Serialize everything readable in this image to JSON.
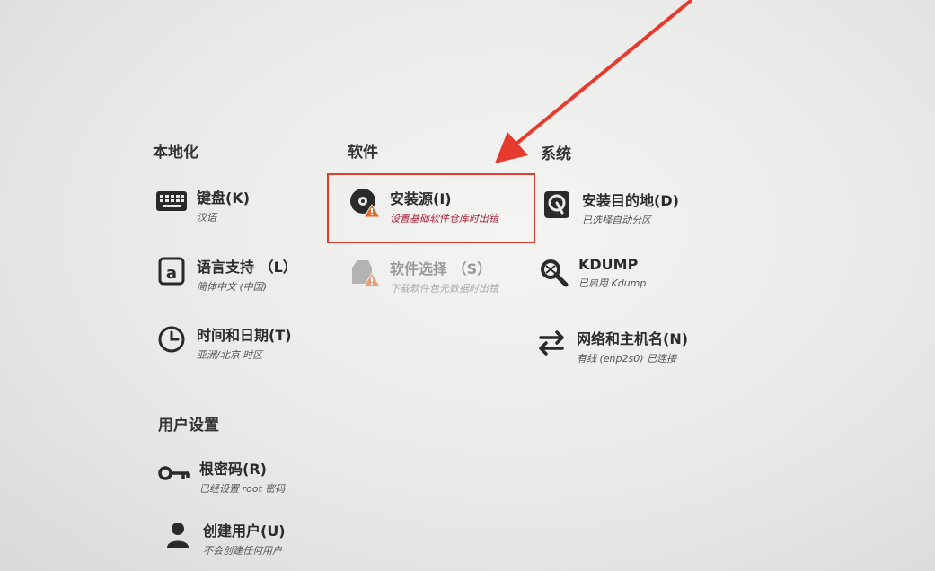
{
  "sections": {
    "localization": "本地化",
    "software": "软件",
    "system": "系统",
    "user_settings": "用户设置"
  },
  "spokes": {
    "keyboard": {
      "title": "键盘(K)",
      "status": "汉语",
      "icon": "keyboard-icon"
    },
    "language": {
      "title": "语言支持 （L）",
      "status": "简体中文 (中国)",
      "icon": "language-icon"
    },
    "time": {
      "title": "时间和日期(T)",
      "status": "亚洲/北京 时区",
      "icon": "clock-icon"
    },
    "install_source": {
      "title": "安装源(I)",
      "status": "设置基础软件仓库时出错",
      "icon": "disc-warning-icon"
    },
    "software_selection": {
      "title": "软件选择 （S）",
      "status": "下载软件包元数据时出错",
      "icon": "package-warning-icon"
    },
    "install_dest": {
      "title": "安装目的地(D)",
      "status": "已选择自动分区",
      "icon": "disk-icon"
    },
    "kdump": {
      "title": "KDUMP",
      "status": "已启用 Kdump",
      "icon": "magnifier-icon"
    },
    "network": {
      "title": "网络和主机名(N)",
      "status": "有线 (enp2s0) 已连接",
      "icon": "network-arrows-icon"
    },
    "root_password": {
      "title": "根密码(R)",
      "status": "已经设置 root 密码",
      "icon": "key-icon"
    },
    "create_user": {
      "title": "创建用户(U)",
      "status": "不会创建任何用户",
      "icon": "user-icon"
    }
  },
  "colors": {
    "warning": "#a8233b",
    "annotation": "#e53a2e"
  }
}
